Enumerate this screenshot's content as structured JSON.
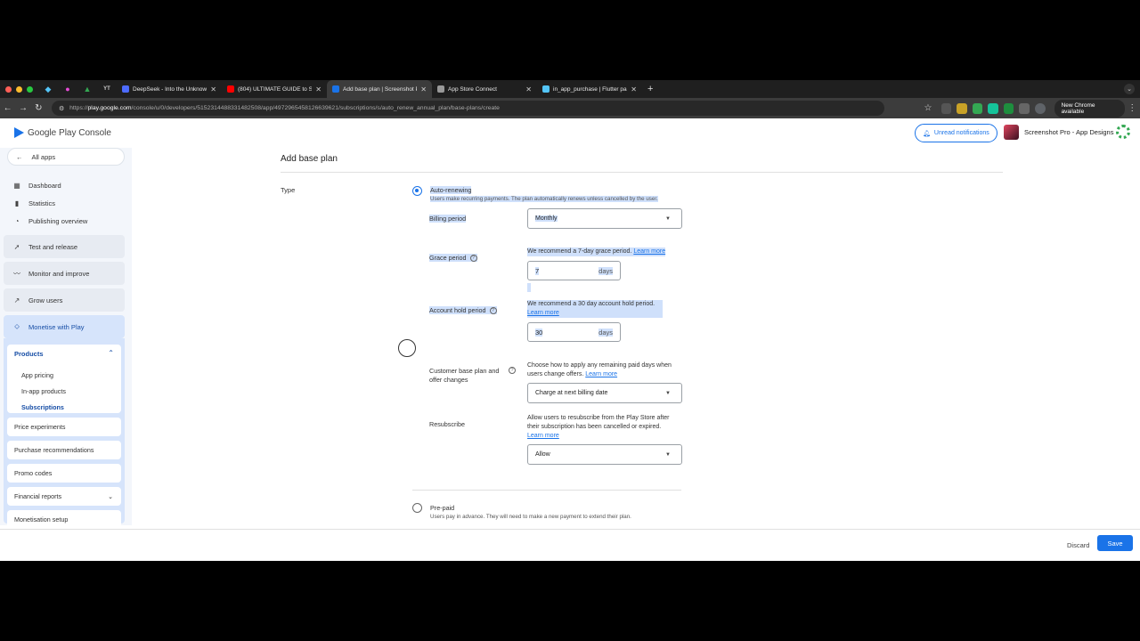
{
  "browser": {
    "tabs": [
      {
        "title": "DeepSeek - Into the Unknown",
        "icon": "deepseek-icon",
        "color": "#4d6bfe"
      },
      {
        "title": "(804) ULTIMATE GUIDE to S",
        "icon": "youtube-icon",
        "color": "#ff0000"
      },
      {
        "title": "Add base plan | Screenshot P",
        "icon": "play-console-icon",
        "color": "#1a73e8"
      },
      {
        "title": "App Store Connect",
        "icon": "apple-icon",
        "color": "#999999"
      },
      {
        "title": "in_app_purchase | Flutter pa",
        "icon": "flutter-icon",
        "color": "#54c5f8"
      }
    ],
    "pinned_tab_label": "YT",
    "url_prefix": "https://",
    "url_site": "play.google.com",
    "url_path": "/console/u/0/developers/5152314488331482508/app/4972965458126639621/subscriptions/s/auto_renew_annual_plan/base-plans/create",
    "new_chrome_label": "New Chrome available"
  },
  "header": {
    "logo_text": "Google Play Console",
    "unread_label": "Unread notifications",
    "app_name": "Screenshot Pro - App Designs"
  },
  "sidebar": {
    "all_apps": "All apps",
    "items": [
      {
        "label": "Dashboard",
        "icon": "dashboard-icon"
      },
      {
        "label": "Statistics",
        "icon": "bar-chart-icon"
      },
      {
        "label": "Publishing overview",
        "icon": "publishing-icon"
      },
      {
        "label": "Test and release",
        "icon": "rocket-icon"
      },
      {
        "label": "Monitor and improve",
        "icon": "trend-icon"
      },
      {
        "label": "Grow users",
        "icon": "grow-icon"
      },
      {
        "label": "Monetise with Play",
        "icon": "tag-icon"
      }
    ],
    "products": {
      "title": "Products",
      "items": [
        "App pricing",
        "In-app products",
        "Subscriptions"
      ],
      "selected": "Subscriptions"
    },
    "cards": [
      "Price experiments",
      "Purchase recommendations",
      "Promo codes",
      "Financial reports",
      "Monetisation setup"
    ]
  },
  "main": {
    "title": "Add base plan",
    "type_label": "Type",
    "auto_renewing": {
      "label": "Auto-renewing",
      "hint": "Users make recurring payments. The plan automatically renews unless cancelled by the user."
    },
    "billing_period": {
      "label": "Billing period",
      "value": "Monthly"
    },
    "grace_period": {
      "label": "Grace period",
      "desc": "We recommend a 7-day grace period.",
      "link": "Learn more",
      "value": "7",
      "unit": "days"
    },
    "account_hold": {
      "label": "Account hold period",
      "desc": "We recommend a 30 day account hold period.",
      "link": "Learn more",
      "value": "30",
      "unit": "days"
    },
    "customer_changes": {
      "label_line1": "Customer base plan and",
      "label_line2": "offer changes",
      "desc_line1": "Choose how to apply any remaining paid days when",
      "desc_line2": "users change offers.",
      "link": "Learn more",
      "value": "Charge at next billing date"
    },
    "resubscribe": {
      "label": "Resubscribe",
      "desc_line1": "Allow users to resubscribe from the Play Store after",
      "desc_line2": "their subscription has been cancelled or expired.",
      "link": "Learn more",
      "value": "Allow"
    },
    "prepaid": {
      "label": "Pre-paid",
      "hint": "Users pay in advance. They will need to make a new payment to extend their plan."
    }
  },
  "footer": {
    "discard": "Discard",
    "save": "Save"
  },
  "colors": {
    "accent": "#1a73e8",
    "selection": "#cfe0fb",
    "sidebar_bg": "#f3f6fb"
  }
}
